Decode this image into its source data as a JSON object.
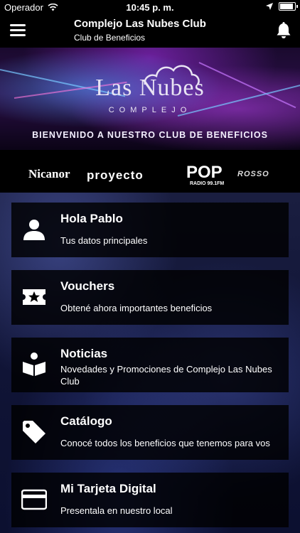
{
  "status": {
    "carrier": "Operador",
    "time": "10:45 p. m."
  },
  "nav": {
    "title": "Complejo Las Nubes Club",
    "subtitle": "Club de Beneficios"
  },
  "banner": {
    "logo_title": "Las Nubes",
    "logo_sub": "COMPLEJO",
    "welcome": "BIENVENIDO A NUESTRO CLUB DE BENEFICIOS"
  },
  "sponsors": {
    "nicanor": "Nicanor",
    "proyecto": "proyecto",
    "pop": "POP",
    "pop_sub": "RADIO 99.1FM",
    "rosso": "ROSSO"
  },
  "cards": [
    {
      "title": "Hola Pablo",
      "desc": "Tus datos principales",
      "icon": "person-icon"
    },
    {
      "title": "Vouchers",
      "desc": "Obtené ahora importantes beneficios",
      "icon": "ticket-icon"
    },
    {
      "title": "Noticias",
      "desc": "Novedades y Promociones de Complejo Las Nubes Club",
      "icon": "reading-icon"
    },
    {
      "title": "Catálogo",
      "desc": "Conocé todos los beneficios que tenemos para vos",
      "icon": "tag-icon"
    },
    {
      "title": "Mi Tarjeta Digital",
      "desc": "Presentala en nuestro local",
      "icon": "card-icon"
    }
  ]
}
